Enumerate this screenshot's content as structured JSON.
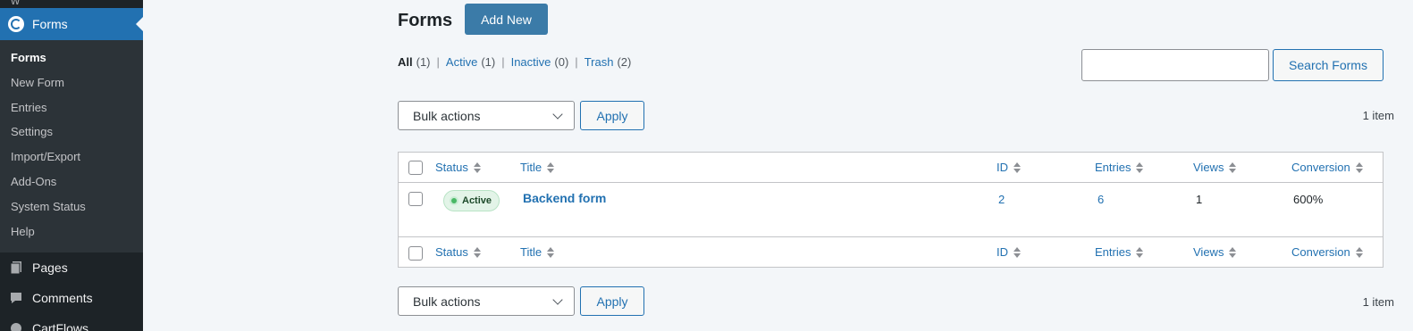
{
  "sidebar": {
    "active_menu": "Forms",
    "submenu": [
      {
        "label": "Forms",
        "current": true
      },
      {
        "label": "New Form",
        "current": false
      },
      {
        "label": "Entries",
        "current": false
      },
      {
        "label": "Settings",
        "current": false
      },
      {
        "label": "Import/Export",
        "current": false
      },
      {
        "label": "Add-Ons",
        "current": false
      },
      {
        "label": "System Status",
        "current": false
      },
      {
        "label": "Help",
        "current": false
      }
    ],
    "menus": [
      {
        "label": "Pages",
        "icon": "pages-icon"
      },
      {
        "label": "Comments",
        "icon": "comments-icon"
      },
      {
        "label": "CartFlows",
        "icon": "cartflows-icon"
      }
    ]
  },
  "header": {
    "title": "Forms",
    "add_new_label": "Add New"
  },
  "filters": {
    "all_label": "All",
    "all_count": "(1)",
    "active_label": "Active",
    "active_count": "(1)",
    "inactive_label": "Inactive",
    "inactive_count": "(0)",
    "trash_label": "Trash",
    "trash_count": "(2)"
  },
  "search": {
    "value": "",
    "button_label": "Search Forms"
  },
  "bulk": {
    "select_label": "Bulk actions",
    "apply_label": "Apply",
    "items_count": "1 item"
  },
  "table": {
    "columns": {
      "status": "Status",
      "title": "Title",
      "id": "ID",
      "entries": "Entries",
      "views": "Views",
      "conversion": "Conversion"
    },
    "rows": [
      {
        "status": "Active",
        "title": "Backend form",
        "id": "2",
        "entries": "6",
        "views": "1",
        "conversion": "600%"
      }
    ]
  },
  "colors": {
    "accent": "#2271b1",
    "sidebar_bg": "#1d2327",
    "submenu_bg": "#2c3338",
    "add_new_bg": "#3b7ba8",
    "badge_bg": "#e3f4e8",
    "badge_dot": "#4ab866"
  }
}
